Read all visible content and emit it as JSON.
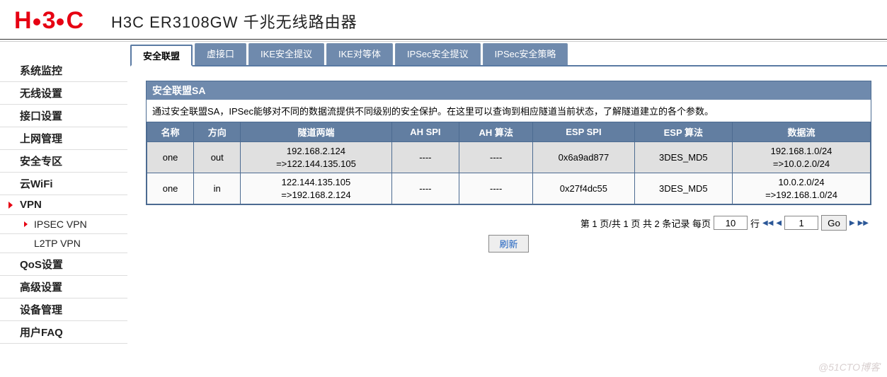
{
  "header": {
    "logo_left": "H",
    "logo_mid": "3",
    "logo_right": "C",
    "device": "H3C ER3108GW 千兆无线路由器"
  },
  "sidebar": {
    "items": [
      {
        "label": "系统监控",
        "level": 1
      },
      {
        "label": "无线设置",
        "level": 1
      },
      {
        "label": "接口设置",
        "level": 1
      },
      {
        "label": "上网管理",
        "level": 1
      },
      {
        "label": "安全专区",
        "level": 1
      },
      {
        "label": "云WiFi",
        "level": 1
      },
      {
        "label": "VPN",
        "level": 1,
        "active": true
      },
      {
        "label": "IPSEC VPN",
        "level": 2,
        "active": true
      },
      {
        "label": "L2TP VPN",
        "level": 2
      },
      {
        "label": "QoS设置",
        "level": 1
      },
      {
        "label": "高级设置",
        "level": 1
      },
      {
        "label": "设备管理",
        "level": 1
      },
      {
        "label": "用户FAQ",
        "level": 1
      }
    ]
  },
  "tabs": [
    {
      "label": "安全联盟",
      "active": true
    },
    {
      "label": "虚接口"
    },
    {
      "label": "IKE安全提议"
    },
    {
      "label": "IKE对等体"
    },
    {
      "label": "IPSec安全提议"
    },
    {
      "label": "IPSec安全策略"
    }
  ],
  "panel": {
    "title": "安全联盟SA",
    "desc": "通过安全联盟SA，IPSec能够对不同的数据流提供不同级别的安全保护。在这里可以查询到相应隧道当前状态，了解隧道建立的各个参数。"
  },
  "table": {
    "headers": [
      "名称",
      "方向",
      "隧道两端",
      "AH SPI",
      "AH 算法",
      "ESP SPI",
      "ESP 算法",
      "数据流"
    ],
    "rows": [
      {
        "name": "one",
        "dir": "out",
        "tunnel": "192.168.2.124\n=>122.144.135.105",
        "ahspi": "----",
        "ahalg": "----",
        "espspi": "0x6a9ad877",
        "espalg": "3DES_MD5",
        "flow": "192.168.1.0/24\n=>10.0.2.0/24"
      },
      {
        "name": "one",
        "dir": "in",
        "tunnel": "122.144.135.105\n=>192.168.2.124",
        "ahspi": "----",
        "ahalg": "----",
        "espspi": "0x27f4dc55",
        "espalg": "3DES_MD5",
        "flow": "10.0.2.0/24\n=>192.168.1.0/24"
      }
    ]
  },
  "pager": {
    "text_prefix": "第 1 页/共 1 页 共 2 条记录 每页",
    "per_page": "10",
    "rows_label": "行",
    "page_no": "1",
    "go_label": "Go"
  },
  "refresh": {
    "label": "刷新"
  },
  "watermark": "@51CTO博客"
}
